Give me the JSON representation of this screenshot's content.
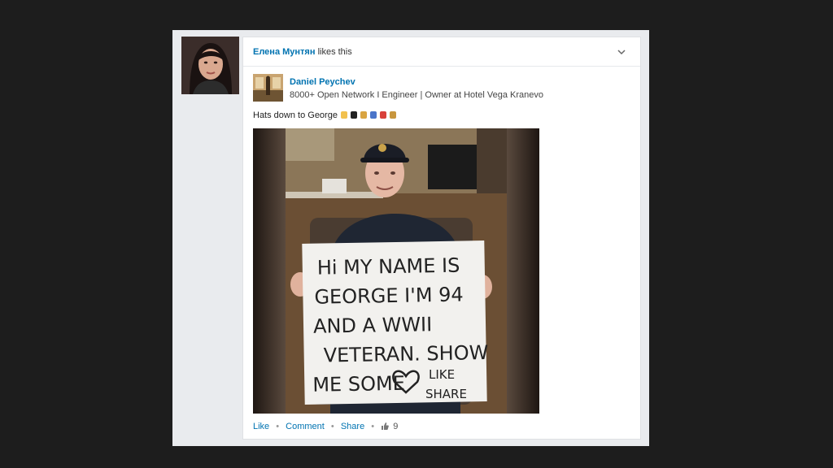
{
  "colors": {
    "background": "#1d1d1d",
    "link": "#0073b1",
    "card": "#ffffff"
  },
  "notification": {
    "liker_name": "Елена Мунтян",
    "action_text": "likes this"
  },
  "post": {
    "author_name": "Daniel Peychev",
    "author_headline": "8000+ Open Network I Engineer | Owner at Hotel Vega Kranevo",
    "text": "Hats down to George",
    "emoji_icons": [
      "victory-hand-icon",
      "top-hat-icon",
      "medal-icon",
      "medal-icon",
      "target-icon",
      "hourglass-icon"
    ],
    "photo": {
      "sign_lines": [
        "Hi MY NAME IS",
        "GEORGE I'M 94",
        "AND A WWII",
        "VETERAN. SHOW",
        "ME SOME",
        "LIKE",
        "SHARE"
      ]
    }
  },
  "actions": {
    "like": "Like",
    "comment": "Comment",
    "share": "Share",
    "like_count": "9"
  }
}
